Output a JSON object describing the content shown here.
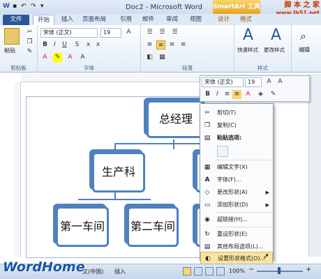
{
  "title_bar": {
    "doc_title": "Doc2 - Microsoft Word",
    "smartart_tools": "SmartArt 工具"
  },
  "watermark_top": {
    "line1": "脚 本 之 家",
    "line2": "www.Jb51.net"
  },
  "tabs": [
    "文件",
    "开始",
    "插入",
    "页面布局",
    "引用",
    "邮件",
    "审阅",
    "视图",
    "设计",
    "格式"
  ],
  "ribbon": {
    "paste_label": "粘贴",
    "font_name": "宋体 (正文)",
    "font_size": "19",
    "groups": {
      "clipboard": "剪贴板",
      "font": "字体",
      "paragraph": "段落",
      "styles": "样式"
    },
    "quick_styles": "快速样式",
    "change_styles": "更改样式",
    "edit": "编辑"
  },
  "mini_toolbar": {
    "font_name": "宋体 (正文)",
    "font_size": "19"
  },
  "smartart": {
    "top": "总经理",
    "mid": "生产科",
    "left_child": "第一车间",
    "right_child": "第二车间"
  },
  "context_menu": {
    "items": [
      "剪切(T)",
      "复制(C)",
      "粘贴选项:",
      "编辑文字(X)",
      "字体(F)...",
      "更改形状(A)",
      "添加形状(D)",
      "超链接(H)...",
      "重设形状(E)",
      "其他布局选项(L)...",
      "设置形状格式(O)..."
    ]
  },
  "status": {
    "language": "文(中国)",
    "mode": "插入",
    "zoom": "100%"
  },
  "watermark_bottom": "WordHome",
  "colors": {
    "accent": "#4f81bd",
    "file_tab": "#2b579a",
    "smartart_tab": "#e9a423"
  }
}
